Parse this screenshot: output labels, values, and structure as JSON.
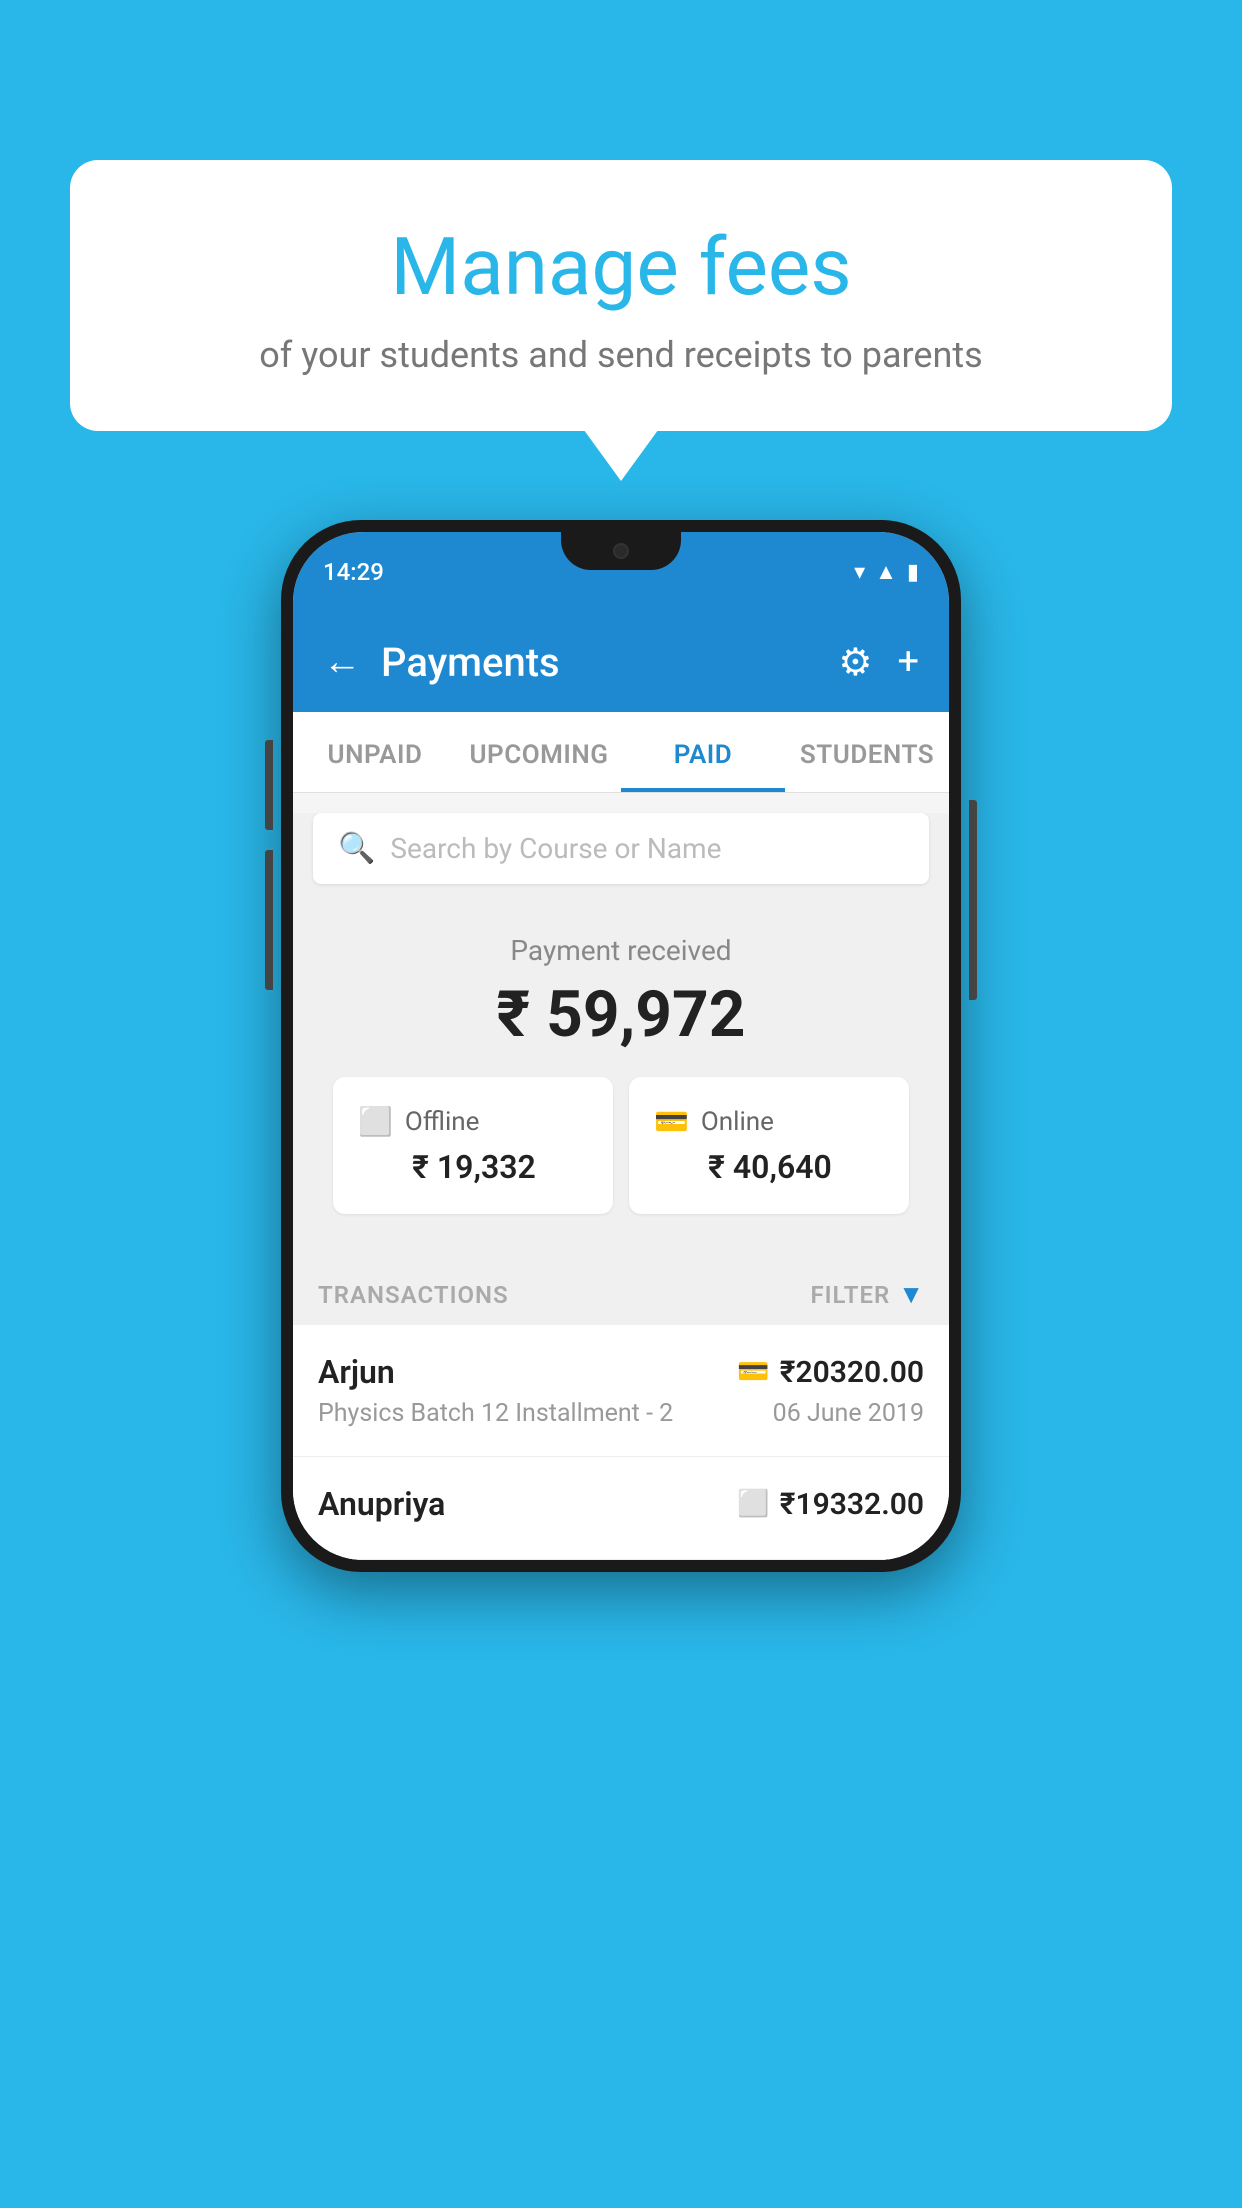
{
  "page": {
    "background_color": "#29B6E8"
  },
  "bubble": {
    "title": "Manage fees",
    "subtitle": "of your students and send receipts to parents"
  },
  "phone": {
    "status_bar": {
      "time": "14:29"
    },
    "app_header": {
      "title": "Payments",
      "back_label": "←",
      "settings_icon": "⚙",
      "add_icon": "+"
    },
    "tabs": [
      {
        "label": "UNPAID",
        "active": false
      },
      {
        "label": "UPCOMING",
        "active": false
      },
      {
        "label": "PAID",
        "active": true
      },
      {
        "label": "STUDENTS",
        "active": false
      }
    ],
    "search": {
      "placeholder": "Search by Course or Name"
    },
    "payment_section": {
      "label": "Payment received",
      "amount": "₹ 59,972",
      "cards": [
        {
          "icon": "offline",
          "label": "Offline",
          "amount": "₹ 19,332"
        },
        {
          "icon": "online",
          "label": "Online",
          "amount": "₹ 40,640"
        }
      ]
    },
    "transactions": {
      "header_label": "TRANSACTIONS",
      "filter_label": "FILTER",
      "rows": [
        {
          "name": "Arjun",
          "detail": "Physics Batch 12 Installment - 2",
          "amount": "₹20320.00",
          "date": "06 June 2019",
          "payment_type": "online"
        },
        {
          "name": "Anupriya",
          "detail": "",
          "amount": "₹19332.00",
          "date": "",
          "payment_type": "offline"
        }
      ]
    }
  }
}
